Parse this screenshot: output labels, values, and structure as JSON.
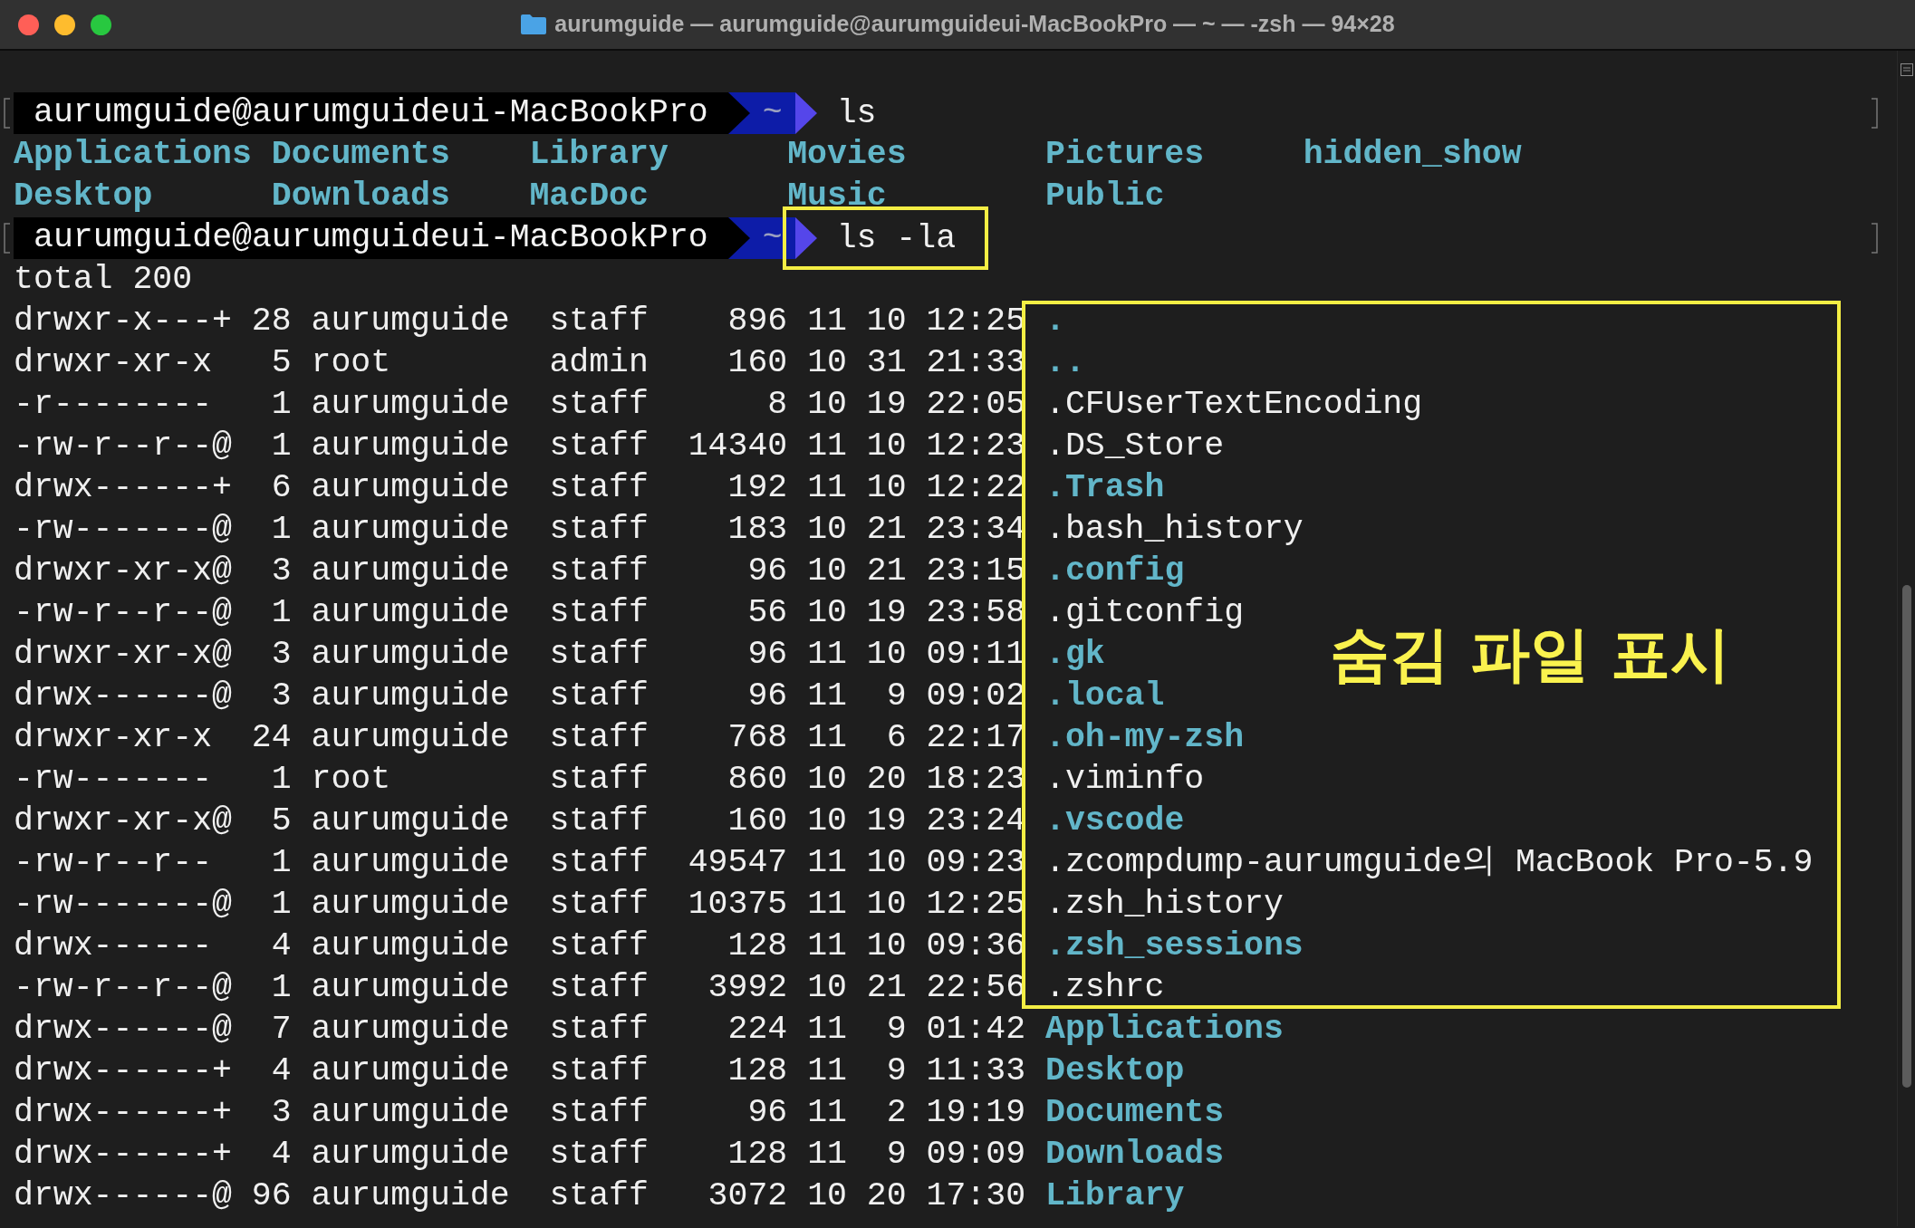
{
  "window": {
    "title": "aurumguide — aurumguide@aurumguideui-MacBookPro — ~ — -zsh — 94×28"
  },
  "terminal": {
    "lines": [
      {
        "kind": "prompt",
        "user_host": "aurumguide@aurumguideui-MacBookPro",
        "directory": "~",
        "command": "ls",
        "highlighted": false
      },
      {
        "kind": "columns",
        "entries": [
          "Applications",
          "Documents",
          "Library",
          "Movies",
          "Pictures",
          "hidden_show"
        ]
      },
      {
        "kind": "columns",
        "entries": [
          "Desktop",
          "Downloads",
          "MacDoc",
          "Music",
          "Public"
        ]
      },
      {
        "kind": "prompt",
        "user_host": "aurumguide@aurumguideui-MacBookPro",
        "directory": "~",
        "command": "ls -la",
        "highlighted": true
      },
      {
        "kind": "text",
        "text": "total 200"
      },
      {
        "kind": "entry",
        "mode": "drwxr-x---+",
        "links": "28",
        "owner": "aurumguide",
        "group": "staff",
        "size": "896",
        "month": "11",
        "day": "10",
        "time": "12:25",
        "name": ".",
        "directory": true,
        "highlighted": true
      },
      {
        "kind": "entry",
        "mode": "drwxr-xr-x",
        "links": "5",
        "owner": "root",
        "group": "admin",
        "size": "160",
        "month": "10",
        "day": "31",
        "time": "21:33",
        "name": "..",
        "directory": true,
        "highlighted": true
      },
      {
        "kind": "entry",
        "mode": "-r--------",
        "links": "1",
        "owner": "aurumguide",
        "group": "staff",
        "size": "8",
        "month": "10",
        "day": "19",
        "time": "22:05",
        "name": ".CFUserTextEncoding",
        "directory": false,
        "highlighted": true
      },
      {
        "kind": "entry",
        "mode": "-rw-r--r--@",
        "links": "1",
        "owner": "aurumguide",
        "group": "staff",
        "size": "14340",
        "month": "11",
        "day": "10",
        "time": "12:23",
        "name": ".DS_Store",
        "directory": false,
        "highlighted": true
      },
      {
        "kind": "entry",
        "mode": "drwx------+",
        "links": "6",
        "owner": "aurumguide",
        "group": "staff",
        "size": "192",
        "month": "11",
        "day": "10",
        "time": "12:22",
        "name": ".Trash",
        "directory": true,
        "highlighted": true
      },
      {
        "kind": "entry",
        "mode": "-rw-------@",
        "links": "1",
        "owner": "aurumguide",
        "group": "staff",
        "size": "183",
        "month": "10",
        "day": "21",
        "time": "23:34",
        "name": ".bash_history",
        "directory": false,
        "highlighted": true
      },
      {
        "kind": "entry",
        "mode": "drwxr-xr-x@",
        "links": "3",
        "owner": "aurumguide",
        "group": "staff",
        "size": "96",
        "month": "10",
        "day": "21",
        "time": "23:15",
        "name": ".config",
        "directory": true,
        "highlighted": true
      },
      {
        "kind": "entry",
        "mode": "-rw-r--r--@",
        "links": "1",
        "owner": "aurumguide",
        "group": "staff",
        "size": "56",
        "month": "10",
        "day": "19",
        "time": "23:58",
        "name": ".gitconfig",
        "directory": false,
        "highlighted": true
      },
      {
        "kind": "entry",
        "mode": "drwxr-xr-x@",
        "links": "3",
        "owner": "aurumguide",
        "group": "staff",
        "size": "96",
        "month": "11",
        "day": "10",
        "time": "09:11",
        "name": ".gk",
        "directory": true,
        "highlighted": true
      },
      {
        "kind": "entry",
        "mode": "drwx------@",
        "links": "3",
        "owner": "aurumguide",
        "group": "staff",
        "size": "96",
        "month": "11",
        "day": "9",
        "time": "09:02",
        "name": ".local",
        "directory": true,
        "highlighted": true
      },
      {
        "kind": "entry",
        "mode": "drwxr-xr-x",
        "links": "24",
        "owner": "aurumguide",
        "group": "staff",
        "size": "768",
        "month": "11",
        "day": "6",
        "time": "22:17",
        "name": ".oh-my-zsh",
        "directory": true,
        "highlighted": true
      },
      {
        "kind": "entry",
        "mode": "-rw-------",
        "links": "1",
        "owner": "root",
        "group": "staff",
        "size": "860",
        "month": "10",
        "day": "20",
        "time": "18:23",
        "name": ".viminfo",
        "directory": false,
        "highlighted": true
      },
      {
        "kind": "entry",
        "mode": "drwxr-xr-x@",
        "links": "5",
        "owner": "aurumguide",
        "group": "staff",
        "size": "160",
        "month": "10",
        "day": "19",
        "time": "23:24",
        "name": ".vscode",
        "directory": true,
        "highlighted": true
      },
      {
        "kind": "entry",
        "mode": "-rw-r--r--",
        "links": "1",
        "owner": "aurumguide",
        "group": "staff",
        "size": "49547",
        "month": "11",
        "day": "10",
        "time": "09:23",
        "name": ".zcompdump-aurumguide의 MacBook Pro-5.9",
        "directory": false,
        "highlighted": true
      },
      {
        "kind": "entry",
        "mode": "-rw-------@",
        "links": "1",
        "owner": "aurumguide",
        "group": "staff",
        "size": "10375",
        "month": "11",
        "day": "10",
        "time": "12:25",
        "name": ".zsh_history",
        "directory": false,
        "highlighted": true
      },
      {
        "kind": "entry",
        "mode": "drwx------",
        "links": "4",
        "owner": "aurumguide",
        "group": "staff",
        "size": "128",
        "month": "11",
        "day": "10",
        "time": "09:36",
        "name": ".zsh_sessions",
        "directory": true,
        "highlighted": true
      },
      {
        "kind": "entry",
        "mode": "-rw-r--r--@",
        "links": "1",
        "owner": "aurumguide",
        "group": "staff",
        "size": "3992",
        "month": "10",
        "day": "21",
        "time": "22:56",
        "name": ".zshrc",
        "directory": false,
        "highlighted": true
      },
      {
        "kind": "entry",
        "mode": "drwx------@",
        "links": "7",
        "owner": "aurumguide",
        "group": "staff",
        "size": "224",
        "month": "11",
        "day": "9",
        "time": "01:42",
        "name": "Applications",
        "directory": true,
        "highlighted": false
      },
      {
        "kind": "entry",
        "mode": "drwx------+",
        "links": "4",
        "owner": "aurumguide",
        "group": "staff",
        "size": "128",
        "month": "11",
        "day": "9",
        "time": "11:33",
        "name": "Desktop",
        "directory": true,
        "highlighted": false
      },
      {
        "kind": "entry",
        "mode": "drwx------+",
        "links": "3",
        "owner": "aurumguide",
        "group": "staff",
        "size": "96",
        "month": "11",
        "day": "2",
        "time": "19:19",
        "name": "Documents",
        "directory": true,
        "highlighted": false
      },
      {
        "kind": "entry",
        "mode": "drwx------+",
        "links": "4",
        "owner": "aurumguide",
        "group": "staff",
        "size": "128",
        "month": "11",
        "day": "9",
        "time": "09:09",
        "name": "Downloads",
        "directory": true,
        "highlighted": false
      },
      {
        "kind": "entry",
        "mode": "drwx------@",
        "links": "96",
        "owner": "aurumguide",
        "group": "staff",
        "size": "3072",
        "month": "10",
        "day": "20",
        "time": "17:30",
        "name": "Library",
        "directory": true,
        "highlighted": false
      }
    ]
  },
  "annotation": {
    "label": "숨김 파일 표시"
  }
}
